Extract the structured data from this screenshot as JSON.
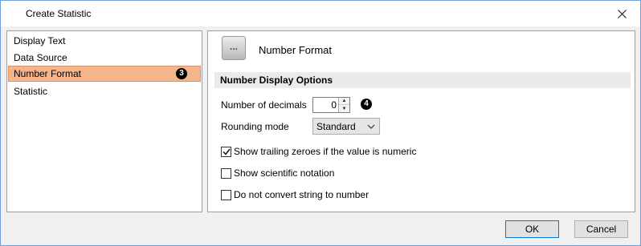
{
  "window": {
    "title": "Create Statistic"
  },
  "nav": {
    "items": [
      {
        "label": "Display Text"
      },
      {
        "label": "Data Source"
      },
      {
        "label": "Number Format",
        "badge": "3"
      },
      {
        "label": "Statistic"
      }
    ],
    "selected_index": 2
  },
  "panel": {
    "header_title": "Number Format",
    "icon_glyph": "...",
    "section_title": "Number Display Options",
    "decimals_label": "Number of decimals",
    "decimals_value": "0",
    "decimals_badge": "4",
    "rounding_label": "Rounding mode",
    "rounding_value": "Standard",
    "checkboxes": [
      {
        "label": "Show trailing zeroes if the value is numeric",
        "checked": true
      },
      {
        "label": "Show scientific notation",
        "checked": false
      },
      {
        "label": "Do not convert string to number",
        "checked": false
      }
    ]
  },
  "buttons": {
    "ok_label": "OK",
    "cancel_label": "Cancel"
  },
  "colors": {
    "selection": "#f4b48c",
    "window_border": "#6f9fd6",
    "default_button_border": "#0078d7"
  }
}
